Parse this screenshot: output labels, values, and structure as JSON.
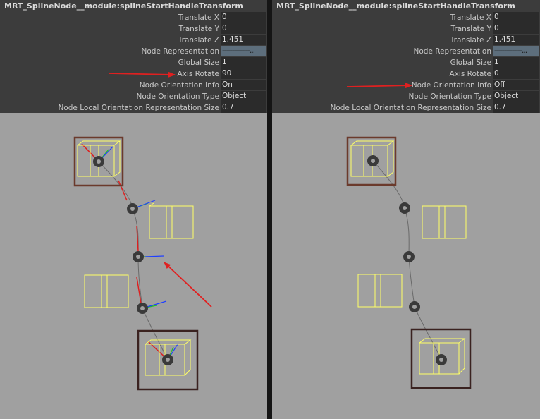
{
  "panels": [
    {
      "title": "MRT_SplineNode__module:splineStartHandleTransform",
      "attributes": [
        {
          "label": "Translate X",
          "value": "0"
        },
        {
          "label": "Translate Y",
          "value": "0"
        },
        {
          "label": "Translate Z",
          "value": "1.451"
        },
        {
          "label": "Node Representation",
          "value": "--------------..."
        },
        {
          "label": "Global Size",
          "value": "1"
        },
        {
          "label": "Axis Rotate",
          "value": "90"
        },
        {
          "label": "Node Orientation Info",
          "value": "On"
        },
        {
          "label": "Node Orientation Type",
          "value": "Object"
        },
        {
          "label": "Node Local Orientation Representation Size",
          "value": "0.7"
        }
      ]
    },
    {
      "title": "MRT_SplineNode__module:splineStartHandleTransform",
      "attributes": [
        {
          "label": "Translate X",
          "value": "0"
        },
        {
          "label": "Translate Y",
          "value": "0"
        },
        {
          "label": "Translate Z",
          "value": "1.451"
        },
        {
          "label": "Node Representation",
          "value": "--------------..."
        },
        {
          "label": "Global Size",
          "value": "1"
        },
        {
          "label": "Axis Rotate",
          "value": "0"
        },
        {
          "label": "Node Orientation Info",
          "value": "Off"
        },
        {
          "label": "Node Orientation Type",
          "value": "Object"
        },
        {
          "label": "Node Local Orientation Representation Size",
          "value": "0.7"
        }
      ]
    }
  ],
  "colors": {
    "annotation_arrow": "#e02020",
    "selection_box": "#6b3a2c",
    "end_box": "#3a2220",
    "wire_box": "#ffff66",
    "axis_red": "#dd2020",
    "axis_green": "#20c020",
    "axis_blue": "#2040ff"
  }
}
